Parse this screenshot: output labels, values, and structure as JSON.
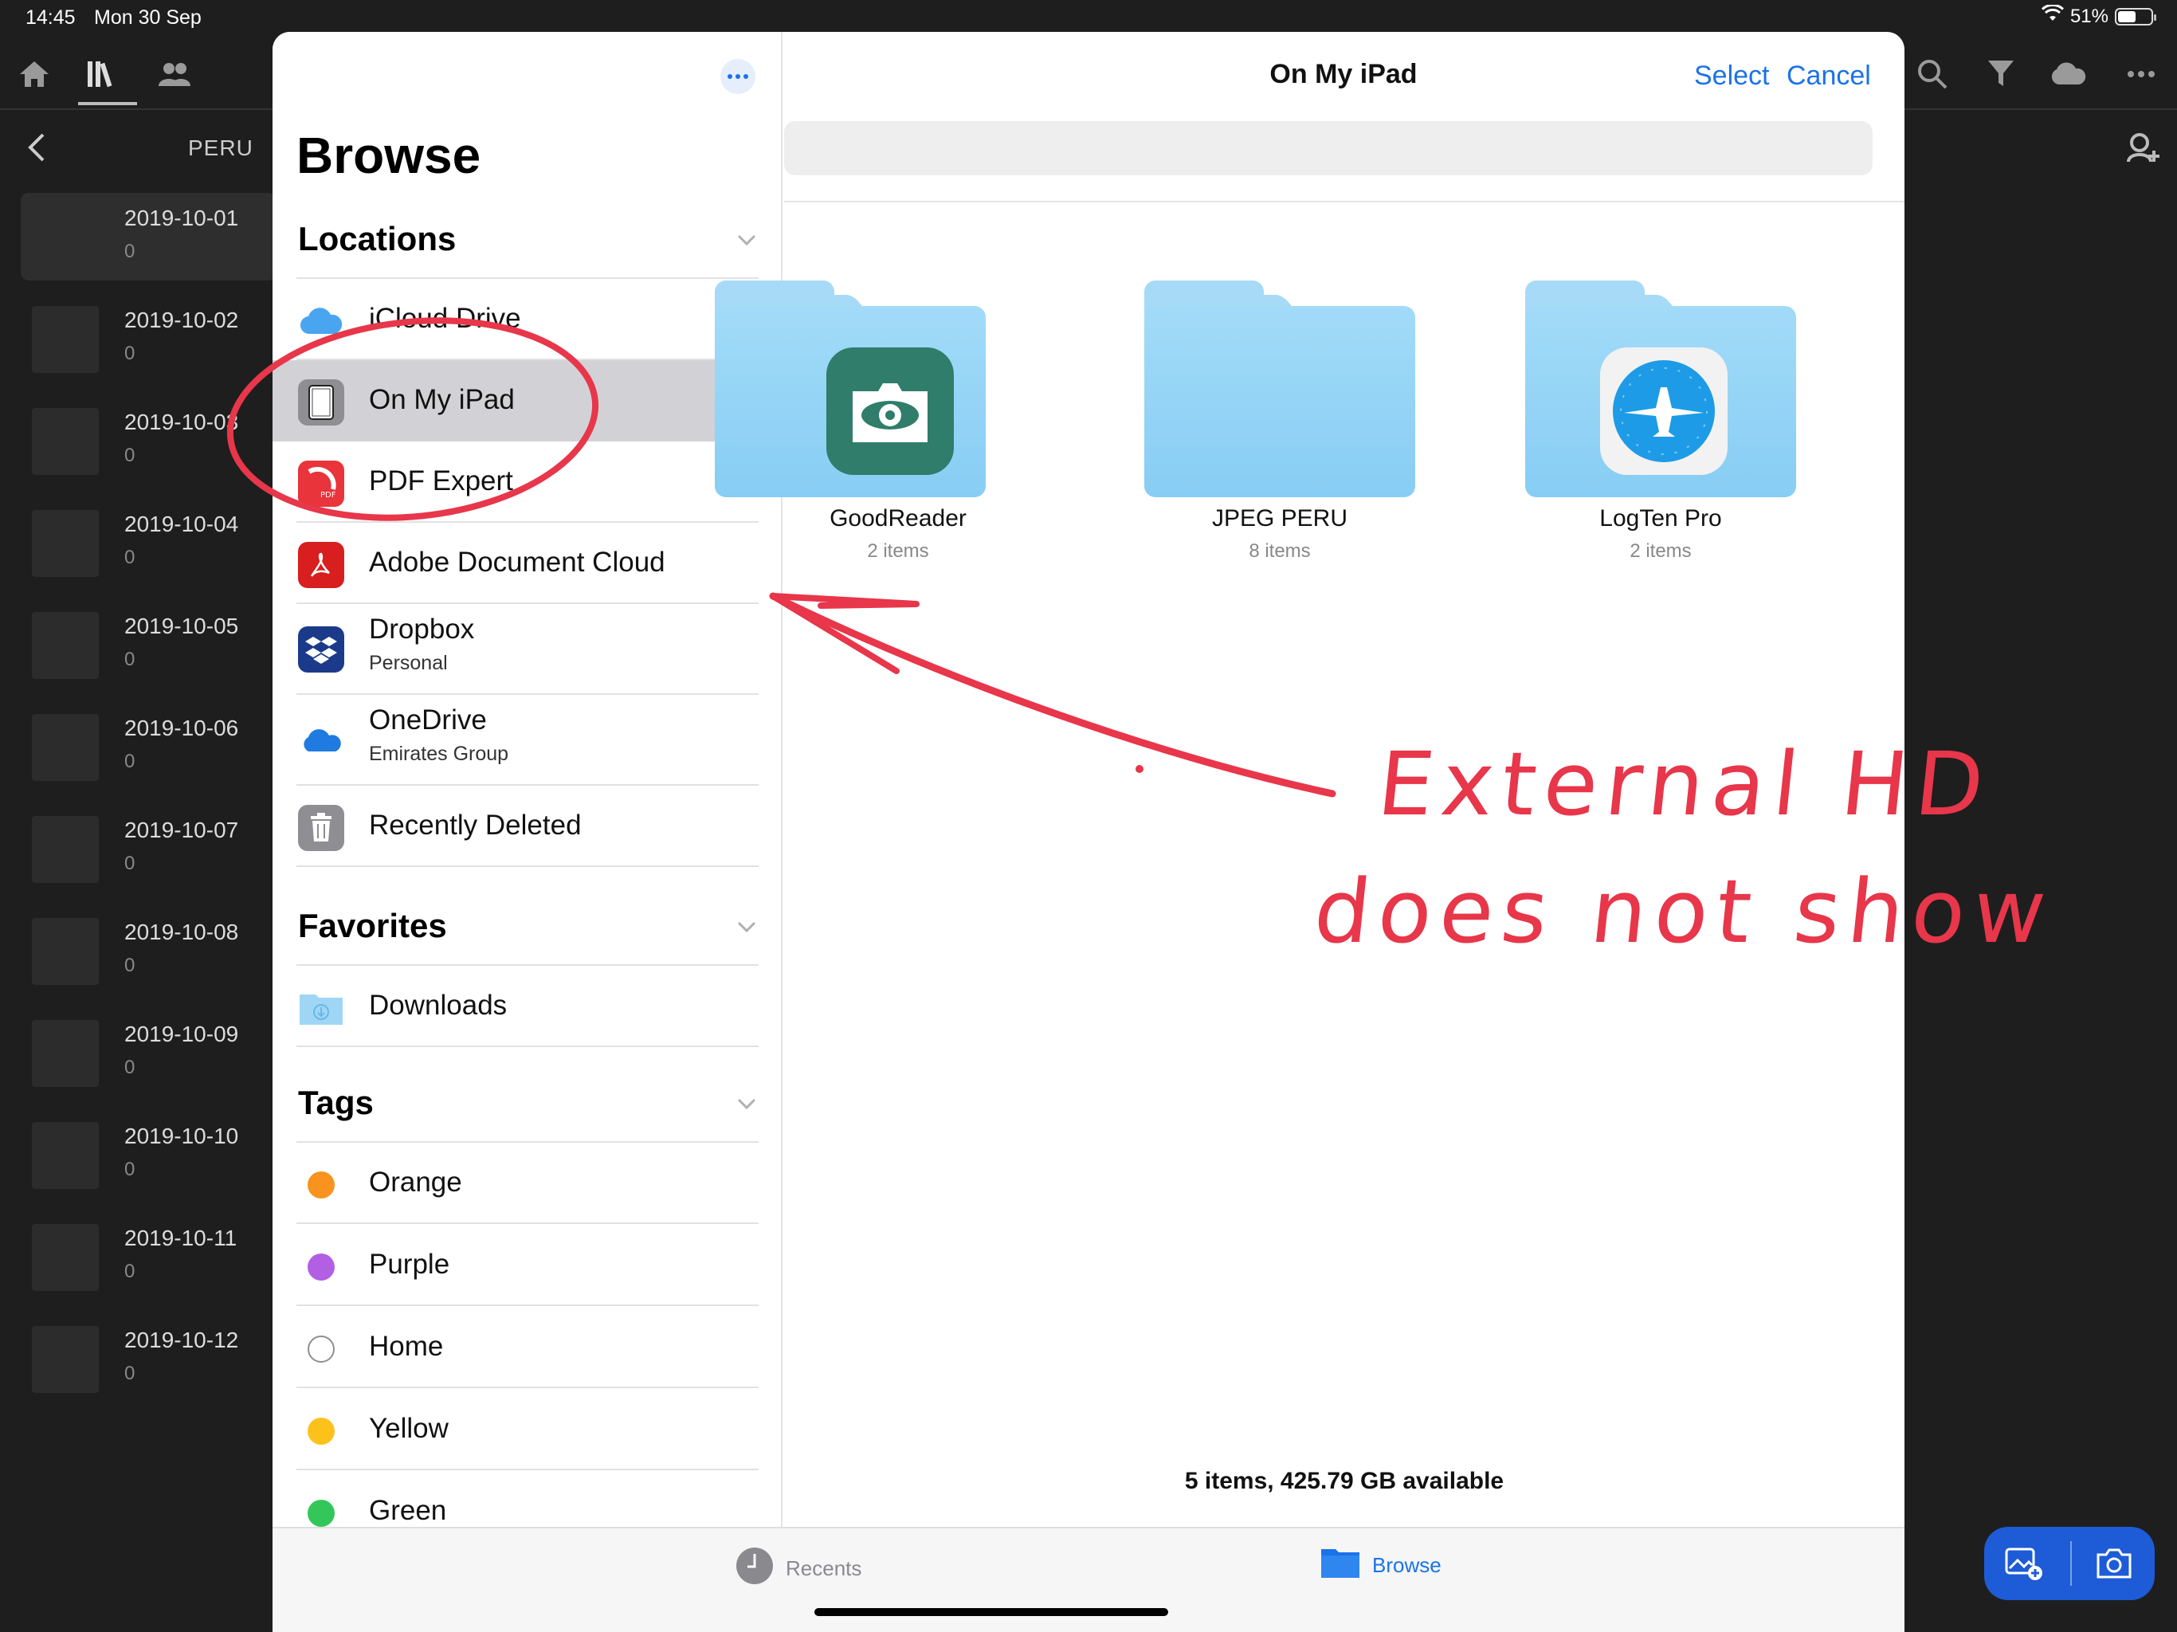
{
  "status_bar": {
    "time": "14:45",
    "date": "Mon 30 Sep",
    "battery": "51%"
  },
  "background_app": {
    "folder_title": "PERU",
    "dates": [
      {
        "label": "2019-10-01",
        "count": "0"
      },
      {
        "label": "2019-10-02",
        "count": "0"
      },
      {
        "label": "2019-10-03",
        "count": "0"
      },
      {
        "label": "2019-10-04",
        "count": "0"
      },
      {
        "label": "2019-10-05",
        "count": "0"
      },
      {
        "label": "2019-10-06",
        "count": "0"
      },
      {
        "label": "2019-10-07",
        "count": "0"
      },
      {
        "label": "2019-10-08",
        "count": "0"
      },
      {
        "label": "2019-10-09",
        "count": "0"
      },
      {
        "label": "2019-10-10",
        "count": "0"
      },
      {
        "label": "2019-10-11",
        "count": "0"
      },
      {
        "label": "2019-10-12",
        "count": "0"
      }
    ]
  },
  "sidebar": {
    "title": "Browse",
    "locations_header": "Locations",
    "locations": [
      {
        "label": "iCloud Drive"
      },
      {
        "label": "On My iPad"
      },
      {
        "label": "PDF Expert"
      },
      {
        "label": "Adobe Document Cloud"
      },
      {
        "label": "Dropbox",
        "sub": "Personal"
      },
      {
        "label": "OneDrive",
        "sub": "Emirates Group"
      },
      {
        "label": "Recently Deleted"
      }
    ],
    "favorites_header": "Favorites",
    "favorites": [
      {
        "label": "Downloads"
      }
    ],
    "tags_header": "Tags",
    "tags": [
      {
        "label": "Orange",
        "color": "#f7931e"
      },
      {
        "label": "Purple",
        "color": "#b25fe3"
      },
      {
        "label": "Home",
        "color": "#ffffff"
      },
      {
        "label": "Yellow",
        "color": "#fcc21b"
      },
      {
        "label": "Green",
        "color": "#33c759"
      }
    ]
  },
  "main": {
    "title": "On My iPad",
    "select_label": "Select",
    "cancel_label": "Cancel",
    "folders": [
      {
        "name": "GoodReader",
        "count": "2 items"
      },
      {
        "name": "JPEG PERU",
        "count": "8 items"
      },
      {
        "name": "LogTen Pro",
        "count": "2 items"
      }
    ],
    "footer": "5 items, 425.79 GB available"
  },
  "tabbar": {
    "recents": "Recents",
    "browse": "Browse"
  },
  "annotation": {
    "line1": "External HD",
    "line2": "does not show"
  },
  "colors": {
    "accent": "#1a73e8",
    "annotation": "#e8364a",
    "selected_row": "#d2d2d6"
  }
}
